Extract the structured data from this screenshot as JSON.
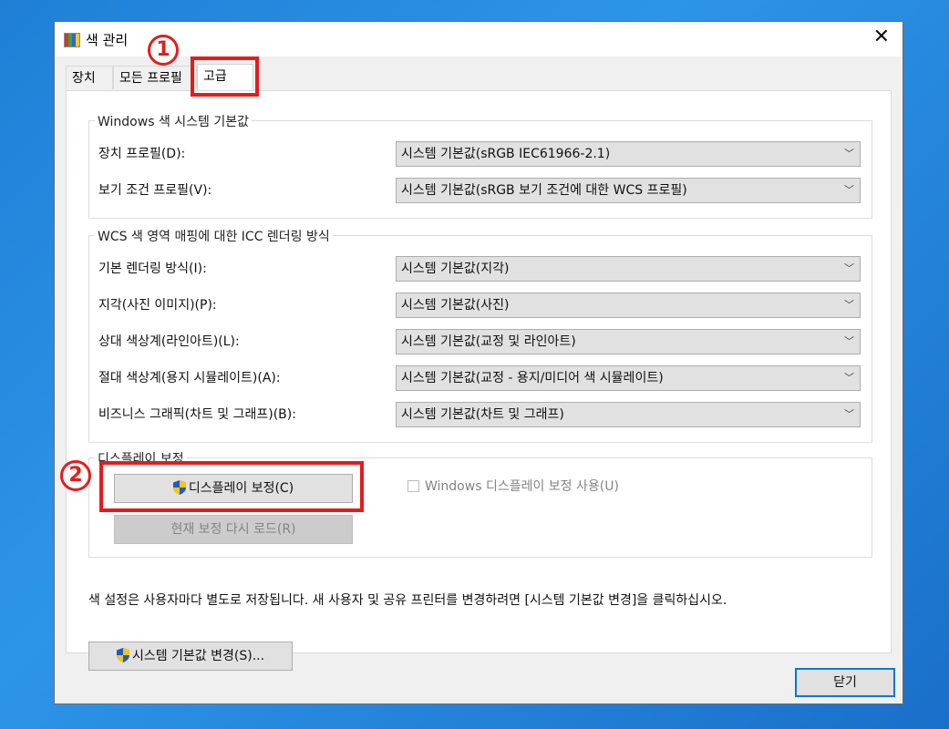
{
  "window": {
    "title": "색 관리",
    "close_glyph": "✕"
  },
  "tabs": [
    {
      "label": "장치"
    },
    {
      "label": "모든 프로필"
    },
    {
      "label": "고급"
    }
  ],
  "group_windows": {
    "legend": "Windows 색 시스템 기본값",
    "rows": [
      {
        "label": "장치 프로필(D):",
        "value": "시스템 기본값(sRGB IEC61966-2.1)"
      },
      {
        "label": "보기 조건 프로필(V):",
        "value": "시스템 기본값(sRGB 보기 조건에 대한 WCS 프로필)"
      }
    ]
  },
  "group_icc": {
    "legend": "WCS 색 영역 매핑에 대한 ICC 렌더링 방식",
    "rows": [
      {
        "label": "기본 렌더링 방식(I):",
        "value": "시스템 기본값(지각)"
      },
      {
        "label": "지각(사진 이미지)(P):",
        "value": "시스템 기본값(사진)"
      },
      {
        "label": "상대 색상계(라인아트)(L):",
        "value": "시스템 기본값(교정 및 라인아트)"
      },
      {
        "label": "절대 색상계(용지 시뮬레이트)(A):",
        "value": "시스템 기본값(교정 - 용지/미디어 색 시뮬레이트)"
      },
      {
        "label": "비즈니스 그래픽(차트 및 그래프)(B):",
        "value": "시스템 기본값(차트 및 그래프)"
      }
    ]
  },
  "group_display": {
    "legend": "디스플레이 보정",
    "calibrate_button": "디스플레이 보정(C)",
    "reload_button": "현재 보정 다시 로드(R)",
    "checkbox_label": "Windows 디스플레이 보정 사용(U)",
    "checkbox_checked": false
  },
  "note": "색 설정은 사용자마다 별도로 저장됩니다. 새 사용자 및 공유 프린터를 변경하려면 [시스템 기본값 변경]을 클릭하십시오.",
  "change_defaults_button": "시스템 기본값 변경(S)...",
  "close_button": "닫기",
  "annotations": {
    "marker1": "1",
    "marker2": "2",
    "color": "#e41c1c"
  },
  "icons": [
    "color-management-icon",
    "shield-icon",
    "chevron-down-icon",
    "close-icon"
  ]
}
